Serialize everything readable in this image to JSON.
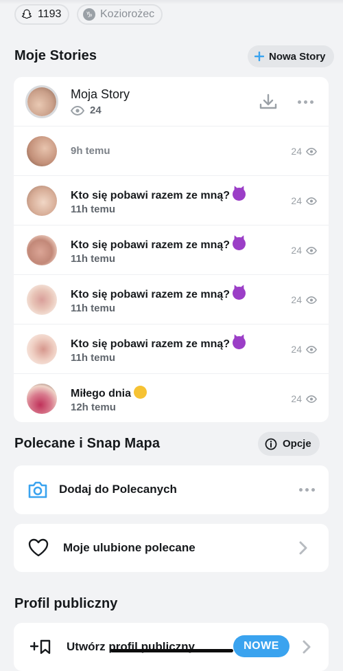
{
  "header": {
    "snap_score": "1193",
    "zodiac": "Koziorożec"
  },
  "my_stories": {
    "title": "Moje Stories",
    "new_story_label": "Nowa Story",
    "my_story": {
      "title": "Moja Story",
      "views": "24"
    },
    "items": [
      {
        "title": "",
        "time": "9h temu",
        "views": "24"
      },
      {
        "title": "Kto się pobawi razem ze mną?",
        "time": "11h temu",
        "views": "24",
        "emoji": "smiling-devil"
      },
      {
        "title": "Kto się pobawi razem ze mną?",
        "time": "11h temu",
        "views": "24",
        "emoji": "smiling-devil"
      },
      {
        "title": "Kto się pobawi razem ze mną?",
        "time": "11h temu",
        "views": "24",
        "emoji": "smiling-devil"
      },
      {
        "title": "Kto się pobawi razem ze mną?",
        "time": "11h temu",
        "views": "24",
        "emoji": "smiling-devil"
      },
      {
        "title": "Miłego dnia",
        "time": "12h temu",
        "views": "24",
        "emoji": "face-blowing-kiss"
      }
    ]
  },
  "spotlight": {
    "title": "Polecane i Snap Mapa",
    "options_label": "Opcje",
    "add_label": "Dodaj do Polecanych",
    "favorites_label": "Moje ulubione polecane"
  },
  "public_profile": {
    "title": "Profil publiczny",
    "create_label": "Utwórz profil publiczny",
    "new_badge": "NOWE"
  },
  "colors": {
    "accent_blue": "#3aa3ef",
    "background": "#f2f3f5",
    "card": "#ffffff",
    "muted_text": "#9aa0a6"
  }
}
